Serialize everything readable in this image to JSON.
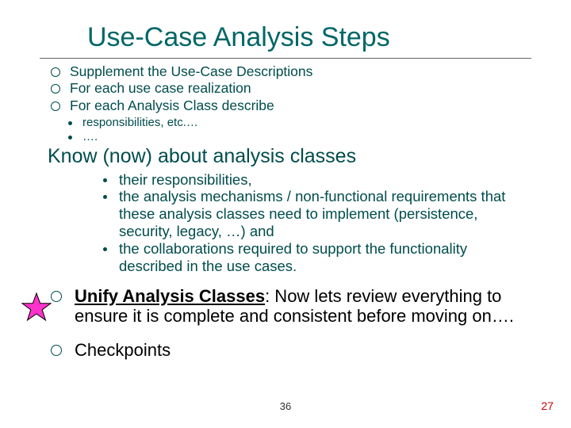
{
  "title": "Use-Case Analysis Steps",
  "top_bullets": [
    "Supplement the Use-Case Descriptions",
    "For each use case realization",
    "For each Analysis Class describe"
  ],
  "sub_bullets_a": [
    "responsibilities, etc.…",
    "…."
  ],
  "know_line": "Know (now) about analysis classes",
  "know_bullets": [
    "their responsibilities,",
    "the analysis mechanisms / non-functional requirements that these analysis classes need to implement (persistence, security, legacy, …)  and",
    "the collaborations required to support the functionality described in the use cases."
  ],
  "unify": {
    "lead": "Unify Analysis Classes",
    "rest": ":  Now lets review everything to ensure it is complete and consistent before moving on…."
  },
  "checkpoints": "Checkpoints",
  "page_center": "36",
  "page_right": "27"
}
